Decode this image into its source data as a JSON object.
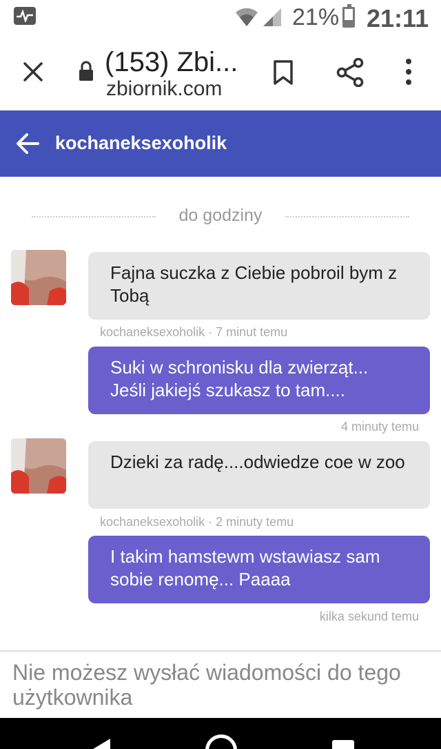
{
  "status_bar": {
    "battery_percent": "21%",
    "time": "21:11",
    "icons": [
      "activity-icon",
      "wifi-icon",
      "signal-icon",
      "battery-icon"
    ]
  },
  "browser": {
    "title": "(153) Zbi...",
    "domain": "zbiornik.com",
    "icons": [
      "close-icon",
      "lock-icon",
      "bookmark-icon",
      "share-icon",
      "more-icon"
    ]
  },
  "chat": {
    "username": "kochaneksexoholik",
    "date_divider": "do godziny",
    "messages": [
      {
        "direction": "incoming",
        "text": "Fajna suczka z Ciebie pobroil bym z Tobą",
        "meta": "kochaneksexoholik · 7 minut temu"
      },
      {
        "direction": "outgoing",
        "text": "Suki w schronisku dla zwierząt... Jeśli jakiejś szukasz to tam....",
        "meta": "4 minuty temu"
      },
      {
        "direction": "incoming",
        "text": "Dzieki za radę....odwiedze coe w zoo",
        "meta": "kochaneksexoholik · 2 minuty temu"
      },
      {
        "direction": "outgoing",
        "text": "I takim hamstewm wstawiasz sam sobie renomę... Paaaa",
        "meta": "kilka sekund temu"
      }
    ],
    "footer_notice": "Nie możesz wysłać wiadomości do tego użytkownika"
  },
  "colors": {
    "header_bg": "#4352b8",
    "outgoing_bubble": "#6a5fcd",
    "incoming_bubble": "#e6e6e6"
  }
}
